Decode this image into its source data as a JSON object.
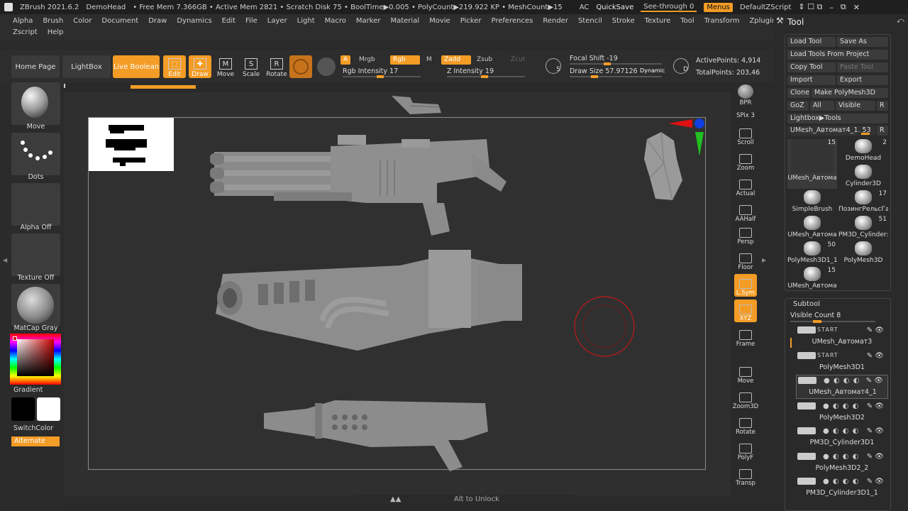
{
  "titlebar": {
    "app": "ZBrush 2021.6.2",
    "doc": "DemoHead",
    "status": "• Free Mem 7.366GB • Active Mem 2821 • Scratch Disk 75 • BoolTime▶0.005 • PolyCount▶219.922 KP • MeshCount▶15",
    "ac": "AC",
    "quicksave": "QuickSave",
    "seethrough": "See-through  0",
    "menus": "Menus",
    "zscript": "DefaultZScript"
  },
  "menubar": {
    "row1": [
      "Alpha",
      "Brush",
      "Color",
      "Document",
      "Draw",
      "Dynamics",
      "Edit",
      "File",
      "Layer",
      "Light",
      "Macro",
      "Marker",
      "Material",
      "Movie",
      "Picker",
      "Preferences",
      "Render",
      "Stencil",
      "Stroke",
      "Texture",
      "Tool",
      "Transform",
      "Zplugin"
    ],
    "row2": [
      "Zscript",
      "Help"
    ]
  },
  "toolbar": {
    "home": "Home Page",
    "lightbox": "LightBox",
    "liveboolean": "Live Boolean",
    "edit": "Edit",
    "draw": "Draw",
    "move": "Move",
    "scale": "Scale",
    "rotate": "Rotate",
    "a": "A",
    "mrgb": "Mrgb",
    "rgb": "Rgb",
    "m": "M",
    "zadd": "Zadd",
    "zsub": "Zsub",
    "zcut": "Zcut",
    "rgb_intensity": "Rgb Intensity 17",
    "z_intensity": "Z Intensity 19",
    "focal_shift": "Focal Shift -19",
    "draw_size": "Draw Size  57.97126",
    "dynamic": "Dynamic",
    "active_points": "ActivePoints: 4,914",
    "total_points": "TotalPoints: 203,46",
    "s": "S",
    "d": "D"
  },
  "leftshelf": {
    "move": "Move",
    "dots": "Dots",
    "alpha": "Alpha Off",
    "texture": "Texture Off",
    "matcap": "MatCap Gray",
    "gradient": "Gradient",
    "switchcolor": "SwitchColor",
    "alternate": "Alternate"
  },
  "rightshelf": [
    "BPR",
    "SPix 3",
    "Scroll",
    "Zoom",
    "Actual",
    "AAHalf",
    "Persp",
    "Floor",
    "L.Sym",
    "XYZ",
    "Frame",
    "Move",
    "Zoom3D",
    "Rotate",
    "PolyF",
    "Transp"
  ],
  "toolpanel": {
    "title": "Tool",
    "load_tool": "Load Tool",
    "save_as": "Save As",
    "load_from_project": "Load Tools From Project",
    "copy_tool": "Copy Tool",
    "paste_tool": "Paste Tool",
    "import": "Import",
    "export": "Export",
    "clone": "Clone",
    "make_polymesh": "Make PolyMesh3D",
    "goz": "GoZ",
    "all": "All",
    "visible": "Visible",
    "r": "R",
    "lightbox_tools": "Lightbox▶Tools",
    "current_tool": "UMesh_Автомат4_1. 53",
    "tools": [
      {
        "name": "UMesh_Автома",
        "count": "15"
      },
      {
        "name": "DemoHead",
        "count": "2"
      },
      {
        "name": "Cylinder3D",
        "count": ""
      },
      {
        "name": "SimpleBrush",
        "count": ""
      },
      {
        "name": "ПозингРельсГа",
        "count": "17"
      },
      {
        "name": "UMesh_Автома",
        "count": ""
      },
      {
        "name": "PM3D_Cylinder:",
        "count": "51"
      },
      {
        "name": "PolyMesh3D1_1",
        "count": "50"
      },
      {
        "name": "PolyMesh3D",
        "count": ""
      },
      {
        "name": "UMesh_Автома",
        "count": "15"
      }
    ],
    "subtool_title": "Subtool",
    "visible_count": "Visible Count 8",
    "subtools": [
      {
        "name": "UMesh_Автомат3",
        "tag": "START"
      },
      {
        "name": "PolyMesh3D1",
        "tag": "START"
      },
      {
        "name": "UMesh_Автомат4_1",
        "tag": ""
      },
      {
        "name": "PolyMesh3D2",
        "tag": ""
      },
      {
        "name": "PM3D_Cylinder3D1",
        "tag": ""
      },
      {
        "name": "PolyMesh3D2_2",
        "tag": ""
      },
      {
        "name": "PM3D_Cylinder3D1_1",
        "tag": ""
      }
    ]
  },
  "bottom_hint": "Alt to Unlock"
}
